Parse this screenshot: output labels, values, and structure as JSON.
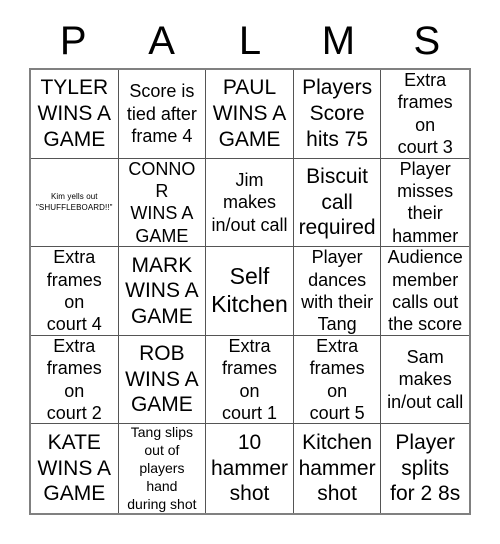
{
  "card": {
    "title_letters": [
      "P",
      "A",
      "L",
      "M",
      "S"
    ],
    "columns": 5,
    "rows": 5,
    "grid_border_color": "#808080",
    "cell_border_color": "#555555",
    "text_color": "#000000",
    "background_color": "#ffffff"
  },
  "cells": [
    {
      "text": "TYLER\nWINS A\nGAME",
      "size": "lg"
    },
    {
      "text": "Score is\ntied after\nframe 4",
      "size": "md"
    },
    {
      "text": "PAUL\nWINS A\nGAME",
      "size": "lg"
    },
    {
      "text": "Players\nScore\nhits 75",
      "size": "lg"
    },
    {
      "text": "Extra\nframes on\ncourt 3",
      "size": "md"
    },
    {
      "text": "Kim yells out\n\"SHUFFLEBOARD!!\"",
      "size": "xs"
    },
    {
      "text": "CONNOR\nWINS A\nGAME",
      "size": "md"
    },
    {
      "text": "Jim\nmakes\nin/out call",
      "size": "md"
    },
    {
      "text": "Biscuit\ncall\nrequired",
      "size": "lg"
    },
    {
      "text": "Player\nmisses\ntheir\nhammer",
      "size": "md"
    },
    {
      "text": "Extra\nframes on\ncourt 4",
      "size": "md"
    },
    {
      "text": "MARK\nWINS A\nGAME",
      "size": "lg"
    },
    {
      "text": "Self\nKitchen",
      "size": "xl"
    },
    {
      "text": "Player\ndances\nwith their\nTang",
      "size": "md"
    },
    {
      "text": "Audience\nmember\ncalls out\nthe score",
      "size": "md"
    },
    {
      "text": "Extra\nframes on\ncourt 2",
      "size": "md"
    },
    {
      "text": "ROB\nWINS A\nGAME",
      "size": "lg"
    },
    {
      "text": "Extra\nframes on\ncourt 1",
      "size": "md"
    },
    {
      "text": "Extra\nframes on\ncourt 5",
      "size": "md"
    },
    {
      "text": "Sam\nmakes\nin/out call",
      "size": "md"
    },
    {
      "text": "KATE\nWINS A\nGAME",
      "size": "lg"
    },
    {
      "text": "Tang slips\nout of\nplayers hand\nduring shot",
      "size": "sm"
    },
    {
      "text": "10\nhammer\nshot",
      "size": "lg"
    },
    {
      "text": "Kitchen\nhammer\nshot",
      "size": "lg"
    },
    {
      "text": "Player\nsplits\nfor 2 8s",
      "size": "lg"
    }
  ]
}
